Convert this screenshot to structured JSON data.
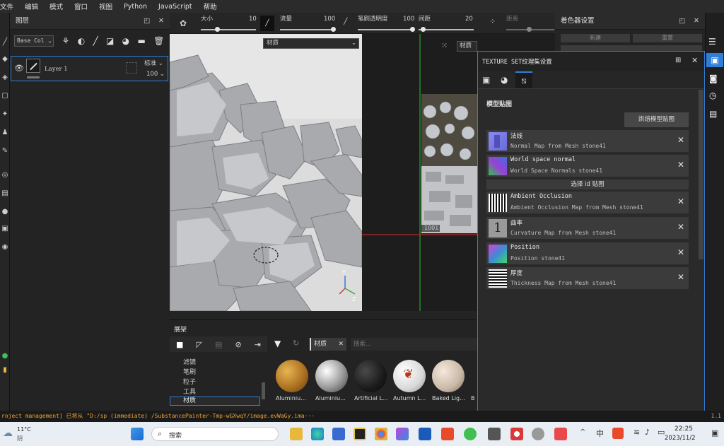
{
  "menu": [
    "文件",
    "编辑",
    "模式",
    "窗口",
    "视图",
    "Python",
    "JavaScript",
    "帮助"
  ],
  "layers": {
    "title": "图层",
    "channel": "Base Col",
    "layer_name": "Layer 1",
    "blend": "标准",
    "opacity": "100"
  },
  "brush": {
    "size_label": "大小",
    "size_value": "10",
    "flow_label": "流量",
    "flow_value": "100",
    "stroke_opacity_label": "笔刷透明度",
    "stroke_opacity_value": "100",
    "spacing_label": "间距",
    "spacing_value": "20",
    "jitter_label": "距离"
  },
  "viewport": {
    "material_dropdown": "材质",
    "uv_material_dropdown": "材质",
    "uv_tile_label": "1001"
  },
  "shader": {
    "title": "着色器设置",
    "btn1": "新建",
    "btn2": "重置"
  },
  "texture_set": {
    "title": "TEXTURE SET纹理集设置",
    "section": "模型贴图",
    "bake_button": "烘焙模型贴图",
    "pick_id": "选择 id 贴图",
    "maps": [
      {
        "title": "法线",
        "sub": "Normal Map from Mesh stone41",
        "thumb": "normal"
      },
      {
        "title": "World space normal",
        "sub": "World Space Normals stone41",
        "thumb": "wsn"
      },
      {
        "title": "Ambient Occlusion",
        "sub": "Ambient Occlusion Map from Mesh stone41",
        "thumb": "noise"
      },
      {
        "title": "曲率",
        "sub": "Curvature Map from Mesh stone41",
        "thumb": "curv"
      },
      {
        "title": "Position",
        "sub": "Position stone41",
        "thumb": "pos"
      },
      {
        "title": "厚度",
        "sub": "Thickness Map from Mesh stone41",
        "thumb": "noise"
      }
    ]
  },
  "shelf": {
    "title": "展架",
    "filter_tag": "材质",
    "search_placeholder": "搜索...",
    "categories": [
      "滤镜",
      "笔刷",
      "粒子",
      "工具",
      "材质"
    ],
    "items": [
      "Aluminiu...",
      "Aluminiu...",
      "Artificial L...",
      "Autumn L...",
      "Baked Lig...",
      "B"
    ]
  },
  "status": {
    "text": "roject management] 已将从 \"D:/sp (immediate) /SubstancePainter-Tmp-wGXwqY/image.evWaGy.ima···",
    "version": "1.1"
  },
  "taskbar": {
    "weather_temp": "11°C",
    "weather_desc": "阴",
    "search": "搜索",
    "time": "22:25",
    "date": "2023/11/2",
    "ime": "中"
  },
  "colors": {
    "accent": "#2f7fd8",
    "status_text": "#e8a33c"
  }
}
